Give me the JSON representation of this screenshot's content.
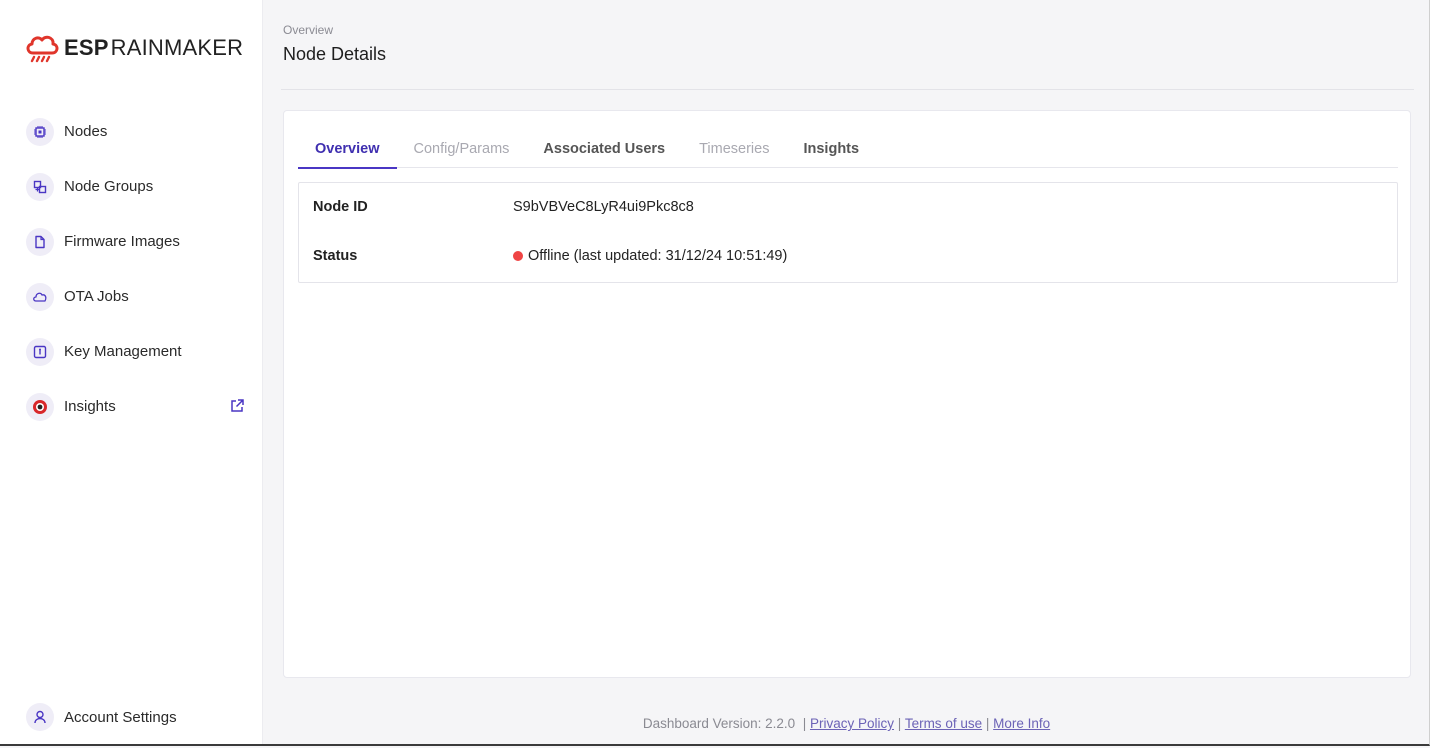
{
  "brand": {
    "esp": "ESP",
    "rainmaker": "RAINMAKER",
    "accent": "#e0352b"
  },
  "sidebar": {
    "items": [
      {
        "label": "Nodes",
        "icon": "chip-icon"
      },
      {
        "label": "Node Groups",
        "icon": "node-groups-icon"
      },
      {
        "label": "Firmware Images",
        "icon": "file-icon"
      },
      {
        "label": "OTA Jobs",
        "icon": "cloud-icon"
      },
      {
        "label": "Key Management",
        "icon": "key-box-icon"
      },
      {
        "label": "Insights",
        "icon": "insights-icon",
        "external": true
      }
    ],
    "account": {
      "label": "Account Settings",
      "icon": "user-icon"
    }
  },
  "header": {
    "breadcrumb": "Overview",
    "title": "Node Details"
  },
  "tabs": [
    {
      "label": "Overview",
      "state": "active"
    },
    {
      "label": "Config/Params",
      "state": "disabled"
    },
    {
      "label": "Associated Users",
      "state": "normal"
    },
    {
      "label": "Timeseries",
      "state": "disabled"
    },
    {
      "label": "Insights",
      "state": "normal"
    }
  ],
  "details": {
    "node_id_label": "Node ID",
    "node_id_value": "S9bVBVeC8LyR4ui9Pkc8c8",
    "status_label": "Status",
    "status_value": "Offline (last updated: 31/12/24 10:51:49)",
    "status_color": "#ef4444"
  },
  "footer": {
    "version": "Dashboard Version: 2.2.0",
    "sep": "|",
    "privacy": "Privacy Policy",
    "terms": "Terms of use",
    "more": "More Info"
  },
  "colors": {
    "primary": "#4a36c4",
    "icon_bg": "#efedf7"
  }
}
